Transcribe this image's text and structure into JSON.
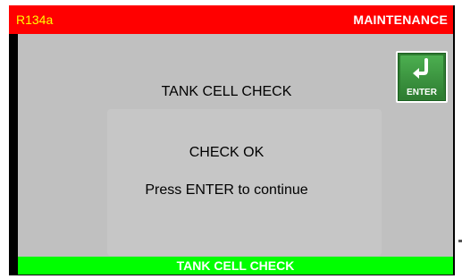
{
  "header": {
    "refrigerant": "R134a",
    "mode": "MAINTENANCE"
  },
  "main": {
    "title": "TANK CELL CHECK",
    "status": "CHECK OK",
    "instruction": "Press ENTER to continue"
  },
  "buttons": {
    "enter_label": "ENTER"
  },
  "footer": {
    "label": "TANK CELL CHECK"
  },
  "colors": {
    "header_bg": "#ff0000",
    "refrigerant_text": "#ffff00",
    "footer_bg": "#00ff00",
    "body_bg": "#c0c0c0",
    "enter_button": "#2e7d32"
  },
  "icons": {
    "enter": "enter-return-arrow-icon"
  }
}
